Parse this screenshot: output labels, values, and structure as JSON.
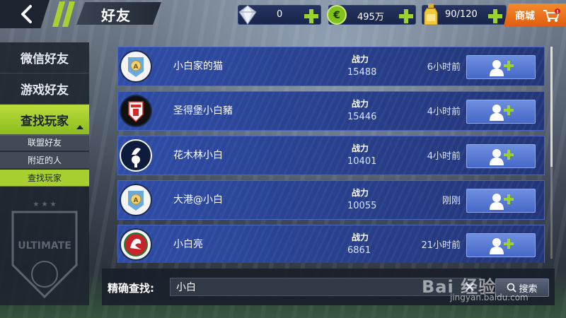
{
  "header": {
    "title": "好友",
    "back_icon": "back-arrow-icon",
    "resources": [
      {
        "icon": "diamond-icon",
        "value": "0"
      },
      {
        "icon": "coin-icon",
        "value": "495万"
      },
      {
        "icon": "energy-bottle-icon",
        "value": "90/120"
      }
    ],
    "shop_label": "商城",
    "shop_alert": "!"
  },
  "sidebar": {
    "tabs": [
      {
        "label": "微信好友"
      },
      {
        "label": "游戏好友"
      },
      {
        "label": "查找玩家",
        "active": true
      }
    ],
    "sub_tabs": [
      {
        "label": "联盟好友"
      },
      {
        "label": "附近的人"
      },
      {
        "label": "查找玩家",
        "active": true
      }
    ],
    "emblem_text": "ULTIMATE"
  },
  "players": [
    {
      "name": "小白家的猫",
      "power_label": "战力",
      "power": "15488",
      "time": "6小时前",
      "avatar": "a-badge-icon",
      "avatar_color": "#6aa9dc"
    },
    {
      "name": "圣得堡小白豬",
      "power_label": "战力",
      "power": "15446",
      "time": "4小时前",
      "avatar": "sevilla-crest-icon",
      "avatar_color": "#d42a2a"
    },
    {
      "name": "花木林小白",
      "power_label": "战力",
      "power": "10401",
      "time": "4小时前",
      "avatar": "cockerel-crest-icon",
      "avatar_color": "#0d1c3d"
    },
    {
      "name": "大港@小白",
      "power_label": "战力",
      "power": "10055",
      "time": "刚刚",
      "avatar": "a-badge-icon",
      "avatar_color": "#6aa9dc"
    },
    {
      "name": "小白亮",
      "power_label": "战力",
      "power": "6861",
      "time": "21小时前",
      "avatar": "dragon-crest-icon",
      "avatar_color": "#c8222a"
    }
  ],
  "search": {
    "label": "精确查找:",
    "value": "小白",
    "button_label": "搜索"
  },
  "watermark": {
    "logo": "Bai 经验",
    "url": "jingyan.baidu.com"
  }
}
